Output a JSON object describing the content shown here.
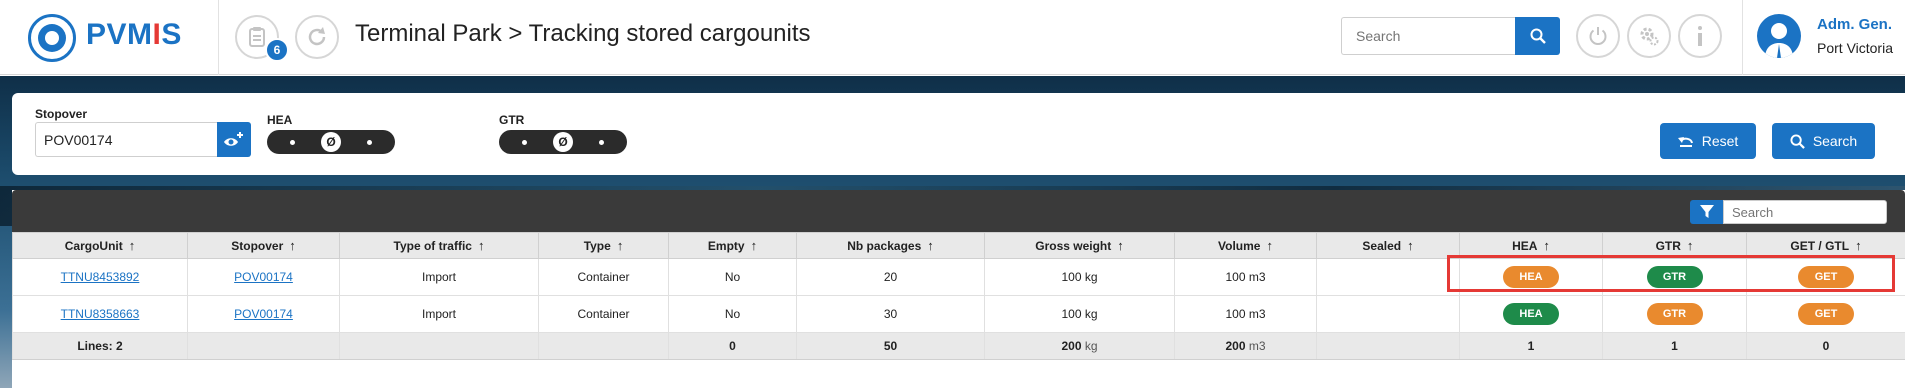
{
  "app": {
    "logo_text_left": "PVM",
    "logo_text_accent": "I",
    "logo_text_right": "S"
  },
  "header": {
    "notification_count": "6",
    "title": "Terminal Park > Tracking stored cargounits",
    "search_placeholder": "Search",
    "user_name": "Adm. Gen.",
    "user_port": "Port Victoria"
  },
  "filters": {
    "stopover_label": "Stopover",
    "stopover_value": "POV00174",
    "hea_label": "HEA",
    "gtr_label": "GTR",
    "null_symbol": "Ø",
    "reset_label": "Reset",
    "search_label": "Search"
  },
  "grid": {
    "search_placeholder": "Search",
    "columns": [
      "CargoUnit",
      "Stopover",
      "Type of traffic",
      "Type",
      "Empty",
      "Nb packages",
      "Gross weight",
      "Volume",
      "Sealed",
      "HEA",
      "GTR",
      "GET / GTL"
    ],
    "rows": [
      {
        "cargo_unit": "TTNU8453892",
        "stopover": "POV00174",
        "traffic": "Import",
        "type": "Container",
        "empty": "No",
        "packages": "20",
        "gross_weight": "100 kg",
        "volume": "100 m3",
        "sealed": "",
        "hea": "HEA",
        "hea_color": "#e98a2e",
        "gtr": "GTR",
        "gtr_color": "#1e8b4a",
        "get": "GET",
        "get_color": "#e98a2e"
      },
      {
        "cargo_unit": "TTNU8358663",
        "stopover": "POV00174",
        "traffic": "Import",
        "type": "Container",
        "empty": "No",
        "packages": "30",
        "gross_weight": "100 kg",
        "volume": "100 m3",
        "sealed": "",
        "hea": "HEA",
        "hea_color": "#1e8b4a",
        "gtr": "GTR",
        "gtr_color": "#e98a2e",
        "get": "GET",
        "get_color": "#e98a2e"
      }
    ],
    "totals": {
      "lines": "Lines: 2",
      "empty": "0",
      "packages": "50",
      "gross_weight": "200",
      "gross_weight_unit": "kg",
      "volume": "200",
      "volume_unit": "m3",
      "hea": "1",
      "gtr": "1",
      "get": "0"
    }
  },
  "colors": {
    "primary": "#1b73c4",
    "orange": "#e98a2e",
    "green": "#1e8b4a",
    "highlight": "#e53935"
  }
}
